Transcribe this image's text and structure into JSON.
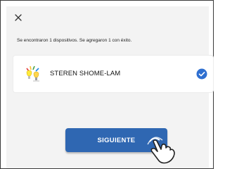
{
  "dialog": {
    "close_icon": "close-icon",
    "message": "Se encontraron 1 dispositivos. Se agregaron 1 con éxito."
  },
  "device": {
    "name": "STEREN SHOME-LAM",
    "icon": "smart-bulb-icon",
    "status_icon": "check-circle-icon",
    "selected": true
  },
  "actions": {
    "next_label": "SIGUIENTE",
    "pointer_icon": "tap-hand-icon"
  },
  "colors": {
    "primary": "#2f67b2",
    "check": "#2e6fd0",
    "background": "#f3f3f3",
    "card": "#ffffff"
  }
}
